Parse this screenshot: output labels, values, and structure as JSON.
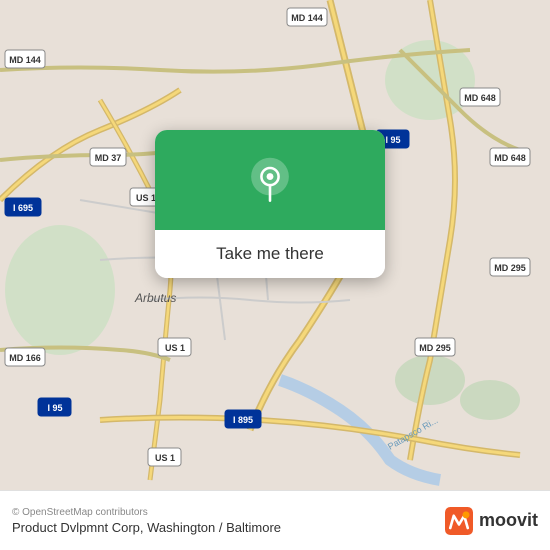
{
  "map": {
    "background_color": "#e8e0d8",
    "popup": {
      "button_label": "Take me there",
      "top_color": "#2eaa5e"
    }
  },
  "footer": {
    "copyright": "© OpenStreetMap contributors",
    "title": "Product Dvlpmnt Corp, Washington / Baltimore",
    "moovit_text": "moovit"
  },
  "road_labels": [
    {
      "id": "md144_top",
      "text": "MD 144"
    },
    {
      "id": "md144_left",
      "text": "MD 144"
    },
    {
      "id": "md37",
      "text": "MD 37"
    },
    {
      "id": "md648_top",
      "text": "MD 648"
    },
    {
      "id": "md648_right",
      "text": "MD 648"
    },
    {
      "id": "md295",
      "text": "MD 295"
    },
    {
      "id": "md295_label",
      "text": "MD 295"
    },
    {
      "id": "md166",
      "text": "MD 166"
    },
    {
      "id": "i695",
      "text": "I 695"
    },
    {
      "id": "i95_top",
      "text": "I 95"
    },
    {
      "id": "i95_left",
      "text": "I 95"
    },
    {
      "id": "i95_bottom",
      "text": "I 95"
    },
    {
      "id": "i895",
      "text": "I 895"
    },
    {
      "id": "us1_left",
      "text": "US 1"
    },
    {
      "id": "us1_mid",
      "text": "US 1"
    },
    {
      "id": "us1_bottom",
      "text": "US 1"
    },
    {
      "id": "arbutus",
      "text": "Arbutus"
    },
    {
      "id": "patapsco",
      "text": "Patapsco River"
    }
  ]
}
